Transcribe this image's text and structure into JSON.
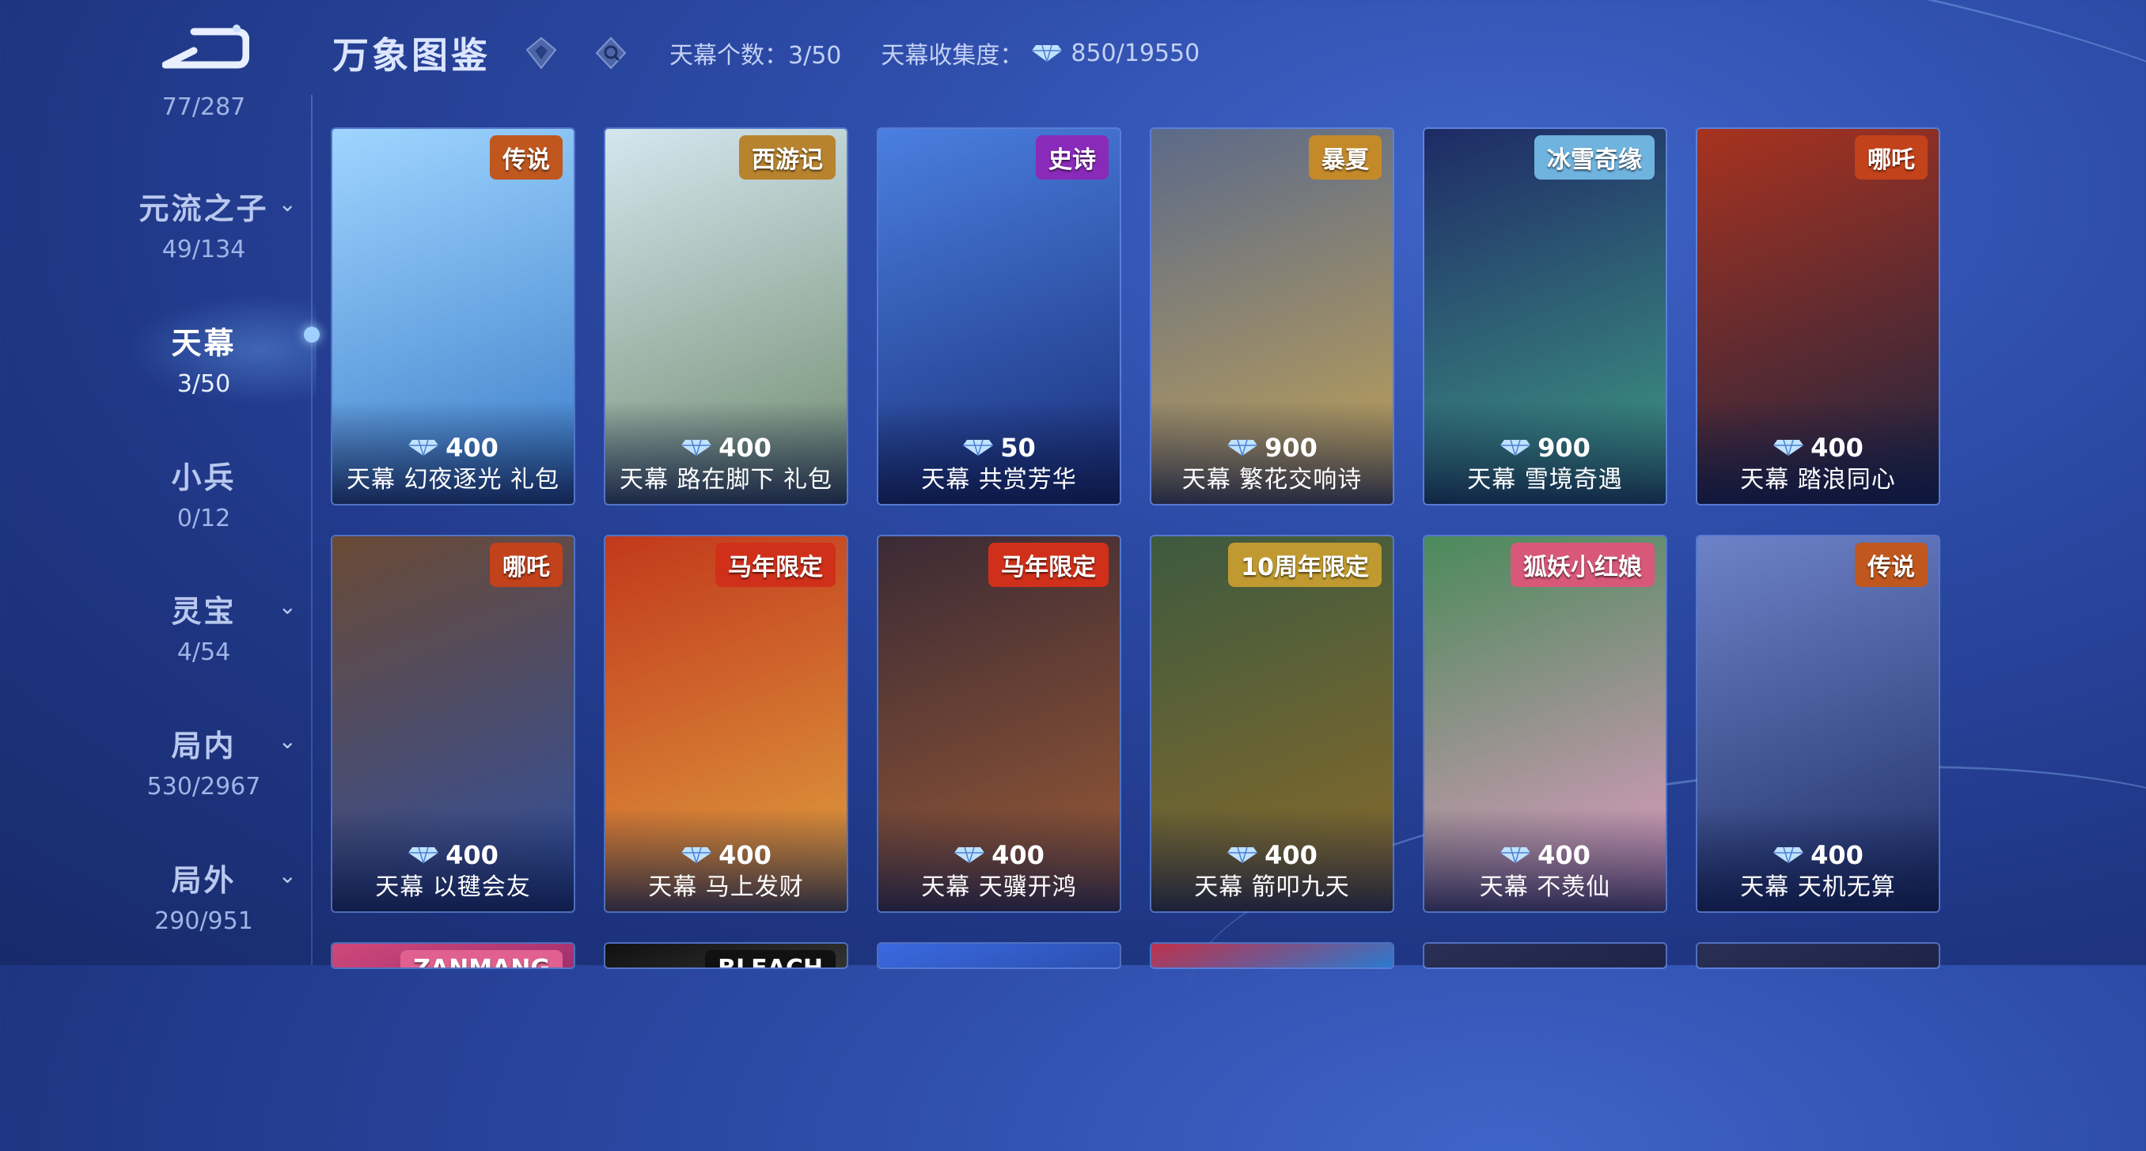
{
  "sidebar": {
    "total": "77/287",
    "items": [
      {
        "label": "元流之子",
        "count": "49/134",
        "has_chevron": true
      },
      {
        "label": "天幕",
        "count": "3/50",
        "has_chevron": false,
        "active": true
      },
      {
        "label": "小兵",
        "count": "0/12",
        "has_chevron": false
      },
      {
        "label": "灵宝",
        "count": "4/54",
        "has_chevron": true
      },
      {
        "label": "局内",
        "count": "530/2967",
        "has_chevron": true
      },
      {
        "label": "局外",
        "count": "290/951",
        "has_chevron": true
      }
    ]
  },
  "header": {
    "title": "万象图鉴",
    "icons": [
      "diamond-filter-icon",
      "search-icon"
    ],
    "count_label": "天幕个数：3/50",
    "collection_label": "天幕收集度：",
    "collection_value": "850/19550"
  },
  "cards": [
    {
      "badge": "传说",
      "price": "400",
      "name": "天幕  幻夜逐光 礼包",
      "colors": [
        "#9fd5ff",
        "#3a7cc9"
      ],
      "badge_color": "#c0571e"
    },
    {
      "badge": "西游记",
      "price": "400",
      "name": "天幕  路在脚下 礼包",
      "colors": [
        "#d5e6ef",
        "#6f8a6d"
      ],
      "badge_color": "#b7832e"
    },
    {
      "badge": "史诗",
      "price": "50",
      "name": "天幕  共赏芳华",
      "colors": [
        "#4a7fe0",
        "#1a2f7a"
      ],
      "badge_color": "#8a2ab8"
    },
    {
      "badge": "暴夏",
      "price": "900",
      "name": "天幕  繁花交响诗",
      "colors": [
        "#5b6a8a",
        "#c2a256"
      ],
      "badge_color": "#c48a2a"
    },
    {
      "badge": "冰雪奇缘",
      "price": "900",
      "name": "天幕  雪境奇遇",
      "colors": [
        "#1e2a66",
        "#3f9a84"
      ],
      "badge_color": "#6fb3df"
    },
    {
      "badge": "哪吒",
      "price": "400",
      "name": "天幕  踏浪同心",
      "colors": [
        "#a8321f",
        "#1d2440"
      ],
      "badge_color": "#c2421c"
    },
    {
      "badge": "哪吒",
      "price": "400",
      "name": "天幕  以毽会友",
      "colors": [
        "#6a4a35",
        "#2f4fa0"
      ],
      "badge_color": "#c2421c"
    },
    {
      "badge": "马年限定",
      "price": "400",
      "name": "天幕  马上发财",
      "colors": [
        "#c2391c",
        "#e0a040"
      ],
      "badge_color": "#d0301a"
    },
    {
      "badge": "马年限定",
      "price": "400",
      "name": "天幕  天骥开鸿",
      "colors": [
        "#3b2a35",
        "#9a5a35"
      ],
      "badge_color": "#d0301a"
    },
    {
      "badge": "10周年限定",
      "price": "400",
      "name": "天幕  箭叩九天",
      "colors": [
        "#3d5a3f",
        "#8a6a2a"
      ],
      "badge_color": "#c09a30"
    },
    {
      "badge": "狐妖小红娘",
      "price": "400",
      "name": "天幕  不羡仙",
      "colors": [
        "#4a8a5a",
        "#e49cc4"
      ],
      "badge_color": "#d8587a"
    },
    {
      "badge": "传说",
      "price": "400",
      "name": "天幕  天机无算",
      "colors": [
        "#6d82c8",
        "#1f2f66"
      ],
      "badge_color": "#c0571e"
    },
    {
      "badge": "ZANMANG",
      "price": "",
      "name": "",
      "colors": [
        "#d0487a",
        "#a03070"
      ],
      "badge_color": "#e06090"
    },
    {
      "badge": "BLEACH",
      "price": "",
      "name": "",
      "colors": [
        "#111111",
        "#333333"
      ],
      "badge_color": "#111111"
    },
    {
      "badge": "",
      "price": "",
      "name": "",
      "colors": [
        "#3a6ae0",
        "#2c4fb0"
      ],
      "badge_color": "#ffffff"
    },
    {
      "badge": "",
      "price": "",
      "name": "",
      "colors": [
        "#c0304a",
        "#2a7ad0"
      ],
      "badge_color": "#e8c040"
    },
    {
      "badge": "",
      "price": "",
      "name": "",
      "colors": [
        "#2a2f55",
        "#1e2448"
      ],
      "badge_color": "#2a2f55"
    },
    {
      "badge": "",
      "price": "",
      "name": "",
      "colors": [
        "#2a2f55",
        "#1e2448"
      ],
      "badge_color": "#2a2f55"
    }
  ],
  "accent": "#9fd0ff"
}
